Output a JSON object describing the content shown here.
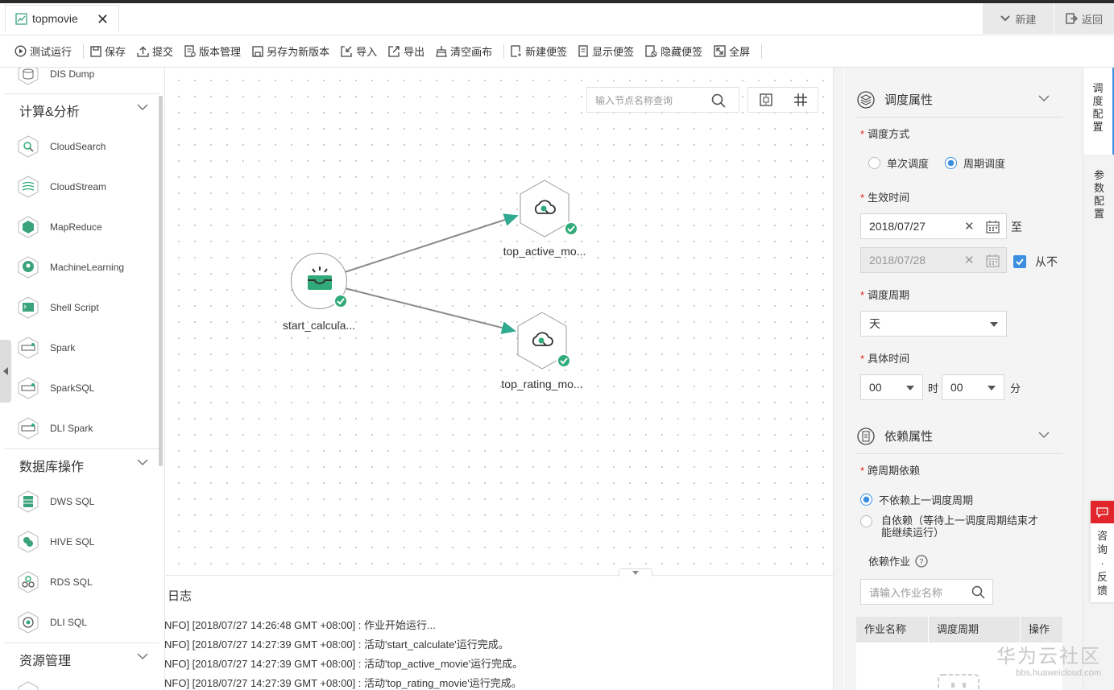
{
  "window": {
    "tab_title": "topmovie",
    "tab_close": "✕",
    "right_buttons": [
      "新建",
      "返回"
    ]
  },
  "toolbar": {
    "items": [
      "测试运行",
      "保存",
      "提交",
      "版本管理",
      "另存为新版本",
      "导入",
      "导出",
      "清空画布",
      "新建便签",
      "显示便签",
      "隐藏便签",
      "全屏"
    ]
  },
  "sidebar": {
    "top_item": "DIS Dump",
    "sections": [
      {
        "title": "计算&分析",
        "items": [
          "CloudSearch",
          "CloudStream",
          "MapReduce",
          "MachineLearning",
          "Shell Script",
          "Spark",
          "SparkSQL",
          "DLI Spark"
        ]
      },
      {
        "title": "数据库操作",
        "items": [
          "DWS SQL",
          "HIVE SQL",
          "RDS SQL",
          "DLI SQL"
        ]
      },
      {
        "title": "资源管理",
        "items": []
      }
    ]
  },
  "canvas": {
    "search_placeholder": "输入节点名称查询",
    "nodes": [
      {
        "label": "start_calcula...",
        "icon": "inbox-icon",
        "status": "success"
      },
      {
        "label": "top_active_mo...",
        "icon": "cloud-search-icon",
        "status": "success"
      },
      {
        "label": "top_rating_mo...",
        "icon": "cloud-search-icon",
        "status": "success"
      }
    ]
  },
  "log": {
    "title": "日志",
    "lines": [
      "NFO] [2018/07/27 14:26:48 GMT +08:00] : 作业开始运行...",
      "NFO] [2018/07/27 14:27:39 GMT +08:00] : 活动'start_calculate'运行完成。",
      "NFO] [2018/07/27 14:27:39 GMT +08:00] : 活动'top_active_movie'运行完成。",
      "NFO] [2018/07/27 14:27:39 GMT +08:00] : 活动'top_rating_movie'运行完成。"
    ]
  },
  "properties": {
    "schedule_section": "调度属性",
    "schedule_mode_label": "调度方式",
    "schedule_mode_options": [
      "单次调度",
      "周期调度"
    ],
    "schedule_mode_selected": "周期调度",
    "effective_time_label": "生效时间",
    "start_date": "2018/07/27",
    "to_label": "至",
    "end_date": "2018/07/28",
    "never_label": "从不",
    "never_checked": true,
    "period_label": "调度周期",
    "period_value": "天",
    "specific_time_label": "具体时间",
    "hour_value": "00",
    "hour_unit": "时",
    "minute_value": "00",
    "minute_unit": "分",
    "dependency_section": "依赖属性",
    "cross_period_label": "跨周期依赖",
    "cross_options": [
      "不依赖上一调度周期",
      "自依赖（等待上一调度周期结束才能继续运行）"
    ],
    "cross_selected": "不依赖上一调度周期",
    "dep_jobs_label": "依赖作业",
    "dep_jobs_placeholder": "请输入作业名称",
    "table_headers": [
      "作业名称",
      "调度周期",
      "操作"
    ]
  },
  "right_tabs": [
    "调度配置",
    "参数配置"
  ],
  "feedback": "咨询·反馈",
  "watermark": {
    "title": "华为云社区",
    "url": "bbs.huaweicloud.com"
  },
  "colors": {
    "accent": "#3c8fe0",
    "success": "#2faa78",
    "required": "#e0201f",
    "edge": "#8a8a8a",
    "arrow": "#2faa90"
  }
}
